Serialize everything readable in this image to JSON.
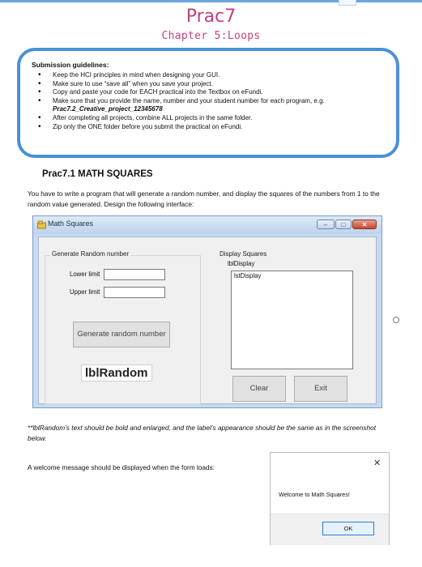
{
  "header": {
    "title": "Prac7",
    "subtitle": "Chapter 5:Loops"
  },
  "guidelines": {
    "heading": "Submission guidelines:",
    "items": [
      "Keep the HCI principles in mind when designing your GUI.",
      "Make sure to use “save all” when you save your project.",
      "Copy and paste your code for EACH practical into the Textbox on eFundi.",
      "Make sure that you provide the name, number and your student number for each program, e.g. ",
      "After completing all projects, combine ALL projects in the same folder.",
      "Zip only the ONE folder before you submit the practical on eFundi."
    ],
    "example_name": "Prac7.2_Creative_project_12345678"
  },
  "section": {
    "heading": "Prac7.1 MATH SQUARES",
    "description": "You have to write a program that will generate a random number, and display the squares of the numbers from 1 to the random value generated. Design the following interface:"
  },
  "form": {
    "window_title": "Math Squares",
    "group_generate": "Generate Random number",
    "lower_label": "Lower limit",
    "upper_label": "Upper limit",
    "generate_button": "Generate random number",
    "lbl_random": "lblRandom",
    "group_display": "Display Squares",
    "lbl_display": "lblDisplay",
    "lst_display": "lstDisplay",
    "clear_button": "Clear",
    "exit_button": "Exit"
  },
  "note": "**lblRandom’s text should be bold and enlarged, and the label’s appearance should be the same as in the screenshot below.",
  "welcome_instruction": "A welcome message should be displayed when the form loads:",
  "message_box": {
    "text": "Welcome to Math Squares!",
    "ok_label": "OK"
  },
  "colors": {
    "title": "#c2417f",
    "box_border": "#4a90d9",
    "window_frame": "#c8daf0"
  }
}
